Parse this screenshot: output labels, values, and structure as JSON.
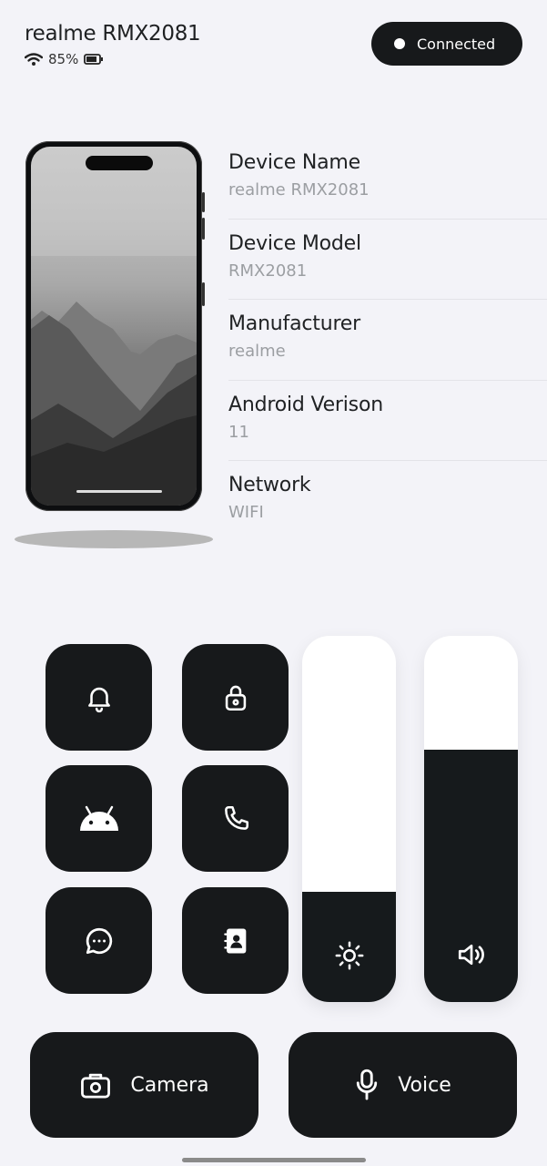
{
  "header": {
    "device_title": "realme RMX2081",
    "battery_text": "85%",
    "battery_level": 0.85,
    "status_label": "Connected"
  },
  "device_info": [
    {
      "label": "Device Name",
      "value": "realme RMX2081"
    },
    {
      "label": "Device Model",
      "value": "RMX2081"
    },
    {
      "label": "Manufacturer",
      "value": "realme"
    },
    {
      "label": "Android Verison",
      "value": "11"
    },
    {
      "label": "Network",
      "value": "WIFI"
    }
  ],
  "controls": {
    "tiles": [
      {
        "name": "notification-button",
        "icon": "bell-icon"
      },
      {
        "name": "lock-button",
        "icon": "lock-icon"
      },
      {
        "name": "android-button",
        "icon": "android-icon"
      },
      {
        "name": "call-button",
        "icon": "phone-icon"
      },
      {
        "name": "message-button",
        "icon": "chat-bubble-icon"
      },
      {
        "name": "contacts-button",
        "icon": "contacts-icon"
      }
    ],
    "brightness": {
      "icon": "sun-icon",
      "level": 0.3
    },
    "volume": {
      "icon": "speaker-icon",
      "level": 0.69
    }
  },
  "actions": {
    "camera_label": "Camera",
    "voice_label": "Voice"
  },
  "colors": {
    "background": "#f3f3f8",
    "dark": "#17191b",
    "muted_text": "#9b9ea2"
  }
}
